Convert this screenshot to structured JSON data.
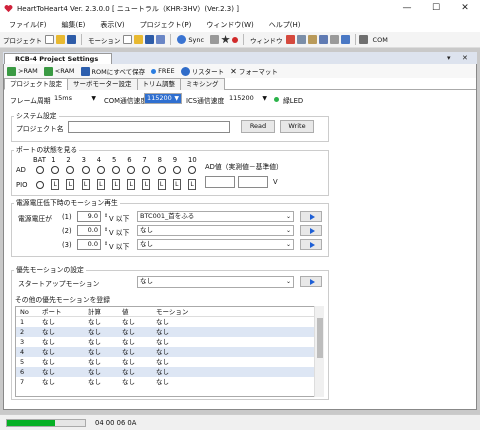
{
  "window": {
    "title": "HeartToHeart4 Ver. 2.3.0.0 [ ニュートラル（KHR-3HV）(Ver.2.3) ]",
    "controls": [
      "—",
      "☐",
      "✕"
    ]
  },
  "menubar": [
    "ファイル(F)",
    "編集(E)",
    "表示(V)",
    "プロジェクト(P)",
    "ウィンドウ(W)",
    "ヘルプ(H)"
  ],
  "toolbar": {
    "project_label": "プロジェクト",
    "motion_label": "モーション",
    "sync_label": "Sync",
    "window_label": "ウィンドウ",
    "com_label": "COM"
  },
  "document": {
    "tab_title": "RCB-4 Project Settings",
    "controls": [
      "▾",
      "✕"
    ],
    "actions": [
      ">RAM",
      "<RAM",
      "ROMにすべて保存",
      "FREE",
      "リスタート",
      "フォーマット"
    ],
    "tabs": [
      "プロジェクト設定",
      "サーボモーター設定",
      "トリム調整",
      "ミキシング"
    ],
    "config": {
      "frame_period_label": "フレーム周期",
      "frame_period_value": "15ms",
      "com_speed_label": "COM通信速度",
      "com_speed_value": "115200",
      "ics_speed_label": "ICS通信速度",
      "ics_speed_value": "115200",
      "led_label": "緑LED",
      "led_color": "#2bb34a"
    },
    "system": {
      "legend": "システム設定",
      "project_name_label": "プロジェクト名",
      "project_name_value": "",
      "read_button": "Read",
      "write_button": "Write"
    },
    "ports": {
      "legend": "ポートの状態を見る",
      "ad_label": "AD",
      "pio_label": "PIO",
      "columns": [
        "BAT",
        "1",
        "2",
        "3",
        "4",
        "5",
        "6",
        "7",
        "8",
        "9",
        "10"
      ],
      "pio_values": [
        "L",
        "L",
        "L",
        "L",
        "L",
        "L",
        "L",
        "L",
        "L",
        "L"
      ],
      "ad_value_label": "AD値（実測値－基準値）",
      "ad_actual": "",
      "ad_reference": "",
      "unit": "V"
    },
    "low_voltage": {
      "legend": "電源電圧低下時のモーション再生",
      "voltage_label": "電源電圧が",
      "rows": [
        {
          "index": "(1)",
          "value": "9.0",
          "unit": "V 以下",
          "motion": "BTC001_首をふる"
        },
        {
          "index": "(2)",
          "value": "0.0",
          "unit": "V 以下",
          "motion": "なし"
        },
        {
          "index": "(3)",
          "value": "0.0",
          "unit": "V 以下",
          "motion": "なし"
        }
      ]
    },
    "priority": {
      "legend": "優先モーションの設定",
      "startup_label": "スタートアップモーション",
      "startup_value": "なし",
      "other_label": "その他の優先モーションを登録",
      "table_headers": [
        "No",
        "ポート",
        "計算",
        "値",
        "モーション"
      ],
      "table_rows": [
        [
          "1",
          "なし",
          "なし",
          "なし",
          "なし"
        ],
        [
          "2",
          "なし",
          "なし",
          "なし",
          "なし"
        ],
        [
          "3",
          "なし",
          "なし",
          "なし",
          "なし"
        ],
        [
          "4",
          "なし",
          "なし",
          "なし",
          "なし"
        ],
        [
          "5",
          "なし",
          "なし",
          "なし",
          "なし"
        ],
        [
          "6",
          "なし",
          "なし",
          "なし",
          "なし"
        ],
        [
          "7",
          "なし",
          "なし",
          "なし",
          "なし"
        ]
      ]
    }
  },
  "statusbar": {
    "progress_fraction": 0.62,
    "text": "04 00 06 0A"
  }
}
